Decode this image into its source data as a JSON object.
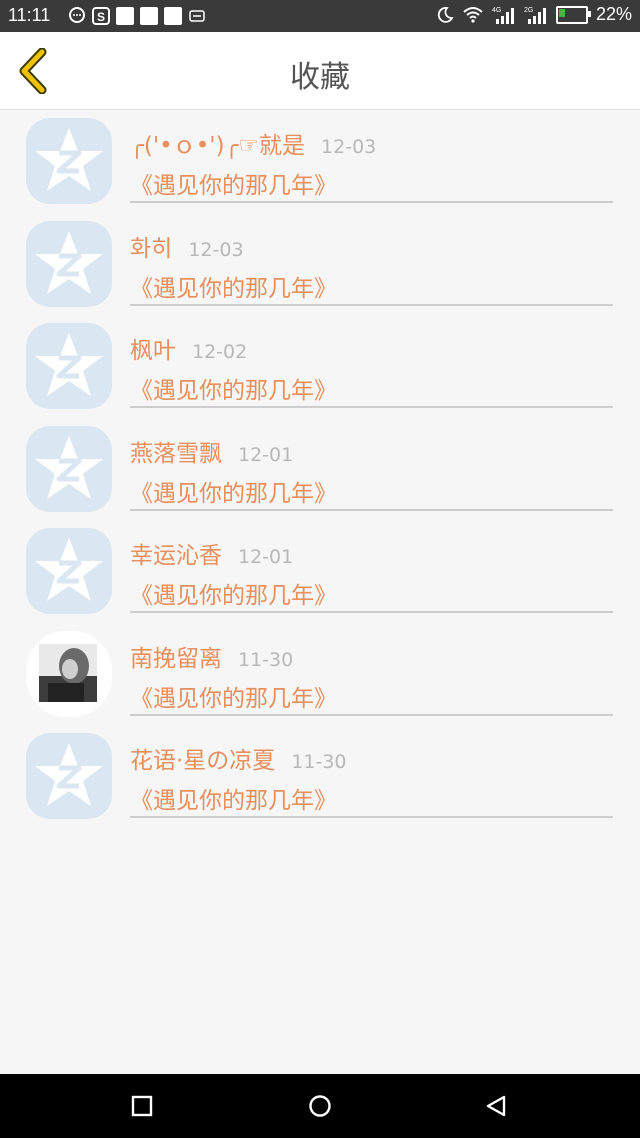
{
  "status_bar": {
    "time": "11:11",
    "battery_percent": "22%",
    "battery_level": 0.22,
    "network_labels": [
      "4G",
      "2G"
    ],
    "icons": [
      "message-icon",
      "s-app-icon",
      "notification-square-icon",
      "notification-square-icon",
      "notification-square-icon",
      "mail-icon",
      "moon-icon",
      "wifi-icon",
      "signal-icon",
      "signal-icon",
      "battery-charging-icon"
    ]
  },
  "header": {
    "title": "收藏",
    "back_icon": "chevron-left-icon",
    "accent_color": "#f2c200"
  },
  "favorites": [
    {
      "name": "╭('•ｏ•')╭☞就是",
      "date": "12-03",
      "book": "《遇见你的那几年》",
      "avatar": "qzone-star"
    },
    {
      "name": "화히",
      "date": "12-03",
      "book": "《遇见你的那几年》",
      "avatar": "qzone-star"
    },
    {
      "name": "枫叶",
      "date": "12-02",
      "book": "《遇见你的那几年》",
      "avatar": "qzone-star"
    },
    {
      "name": "燕落雪飘",
      "date": "12-01",
      "book": "《遇见你的那几年》",
      "avatar": "qzone-star"
    },
    {
      "name": "幸运沁香",
      "date": "12-01",
      "book": "《遇见你的那几年》",
      "avatar": "qzone-star"
    },
    {
      "name": "南挽留离",
      "date": "11-30",
      "book": "《遇见你的那几年》",
      "avatar": "photo"
    },
    {
      "name": "花语·星の凉夏",
      "date": "11-30",
      "book": "《遇见你的那几年》",
      "avatar": "qzone-star"
    }
  ],
  "colors": {
    "name_color": "#e88f5c",
    "date_color": "#b8b8b8",
    "background": "#f6f6f6"
  },
  "nav_bar": {
    "buttons": [
      "recent-apps-icon",
      "home-icon",
      "back-triangle-icon"
    ]
  }
}
